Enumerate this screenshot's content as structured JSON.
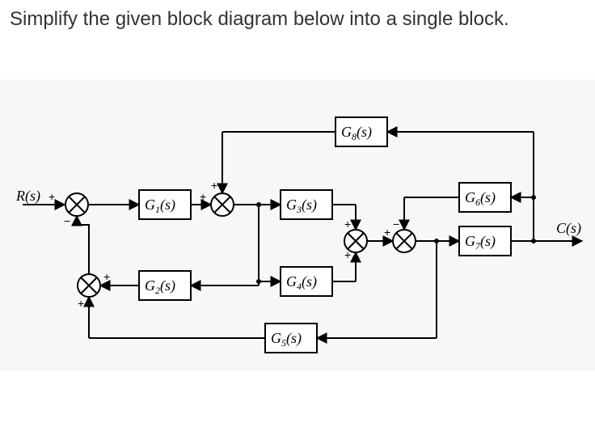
{
  "question_text": "Simplify the given block diagram below into a single block.",
  "diagram": {
    "input_label": "R(s)",
    "output_label": "C(s)",
    "blocks": {
      "G1": "G1(s)",
      "G2": "G2(s)",
      "G3": "G3(s)",
      "G4": "G4(s)",
      "G5": "G5(s)",
      "G6": "G6(s)",
      "G7": "G7(s)",
      "G8": "G8(s)"
    },
    "signs": {
      "plus": "+",
      "minus": "−"
    }
  }
}
